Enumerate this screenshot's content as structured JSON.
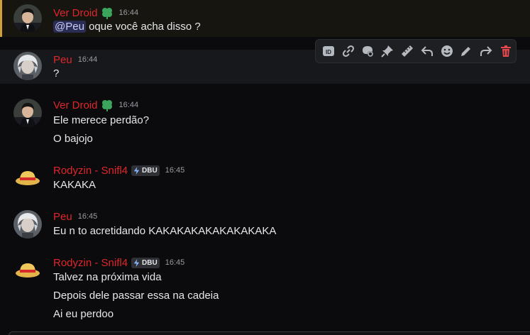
{
  "colors": {
    "username": "#e0262a",
    "mention_highlight": "#cfa03a",
    "delete": "#e5484d",
    "badge_leaf": "#3ba55c"
  },
  "messages": [
    {
      "author": "Ver Droid",
      "badge_icon": "clover-leaf-icon",
      "time": "16:44",
      "mention": "@Peu",
      "lines": [
        " oque você acha disso ?"
      ]
    },
    {
      "author": "Peu",
      "time": "16:44",
      "lines": [
        "?"
      ]
    },
    {
      "author": "Ver Droid",
      "badge_icon": "clover-leaf-icon",
      "time": "16:44",
      "lines": [
        "Ele merece perdão?",
        "O bajojo"
      ]
    },
    {
      "author": "Rodyzin - Snifl4",
      "tag": "DBU",
      "time": "16:45",
      "lines": [
        "KAKAKA"
      ]
    },
    {
      "author": "Peu",
      "time": "16:45",
      "lines": [
        "Eu n to acretidando KAKAKAKAKAKAKAKAKA"
      ]
    },
    {
      "author": "Rodyzin - Snifl4",
      "tag": "DBU",
      "time": "16:45",
      "lines": [
        "Talvez na próxima vida",
        "Depois dele passar essa na cadeia",
        "Ai eu perdoo"
      ]
    }
  ],
  "toolbar": {
    "icons": [
      "id-icon",
      "link-icon",
      "forum-icon",
      "pin-icon",
      "ruler-icon",
      "reply-icon",
      "emoji-icon",
      "edit-icon",
      "forward-icon",
      "trash-icon"
    ]
  }
}
